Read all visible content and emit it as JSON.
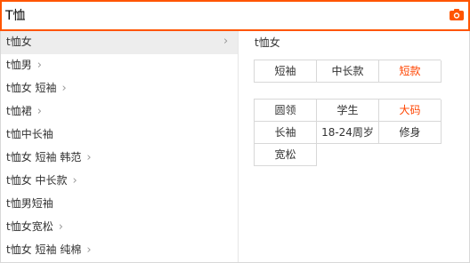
{
  "search": {
    "value": "T恤"
  },
  "icons": {
    "camera": "camera-icon",
    "arrow": "chevron-right-icon"
  },
  "colors": {
    "accent": "#ff5500",
    "hot_tag": "#ff4400"
  },
  "suggestions": [
    {
      "text": "t恤女",
      "has_arrow": true,
      "active": true
    },
    {
      "text": "t恤男",
      "has_arrow": true
    },
    {
      "text": "t恤女 短袖",
      "has_arrow": true
    },
    {
      "text": "t恤裙",
      "has_arrow": true
    },
    {
      "text": "t恤中长袖",
      "has_arrow": false
    },
    {
      "text": "t恤女 短袖 韩范",
      "has_arrow": true
    },
    {
      "text": "t恤女 中长款",
      "has_arrow": true
    },
    {
      "text": "t恤男短袖",
      "has_arrow": false
    },
    {
      "text": "t恤女宽松",
      "has_arrow": true
    },
    {
      "text": "t恤女 短袖 纯棉",
      "has_arrow": true
    }
  ],
  "arrow_glyph": "›",
  "panel": {
    "title": "t恤女",
    "group1": [
      {
        "label": "短袖",
        "hot": false
      },
      {
        "label": "中长款",
        "hot": false
      },
      {
        "label": "短款",
        "hot": true
      }
    ],
    "group2": [
      {
        "label": "圆领",
        "hot": false
      },
      {
        "label": "学生",
        "hot": false
      },
      {
        "label": "大码",
        "hot": true
      },
      {
        "label": "长袖",
        "hot": false
      },
      {
        "label": "18-24周岁",
        "hot": false
      },
      {
        "label": "修身",
        "hot": false
      },
      {
        "label": "宽松",
        "hot": false
      }
    ]
  }
}
